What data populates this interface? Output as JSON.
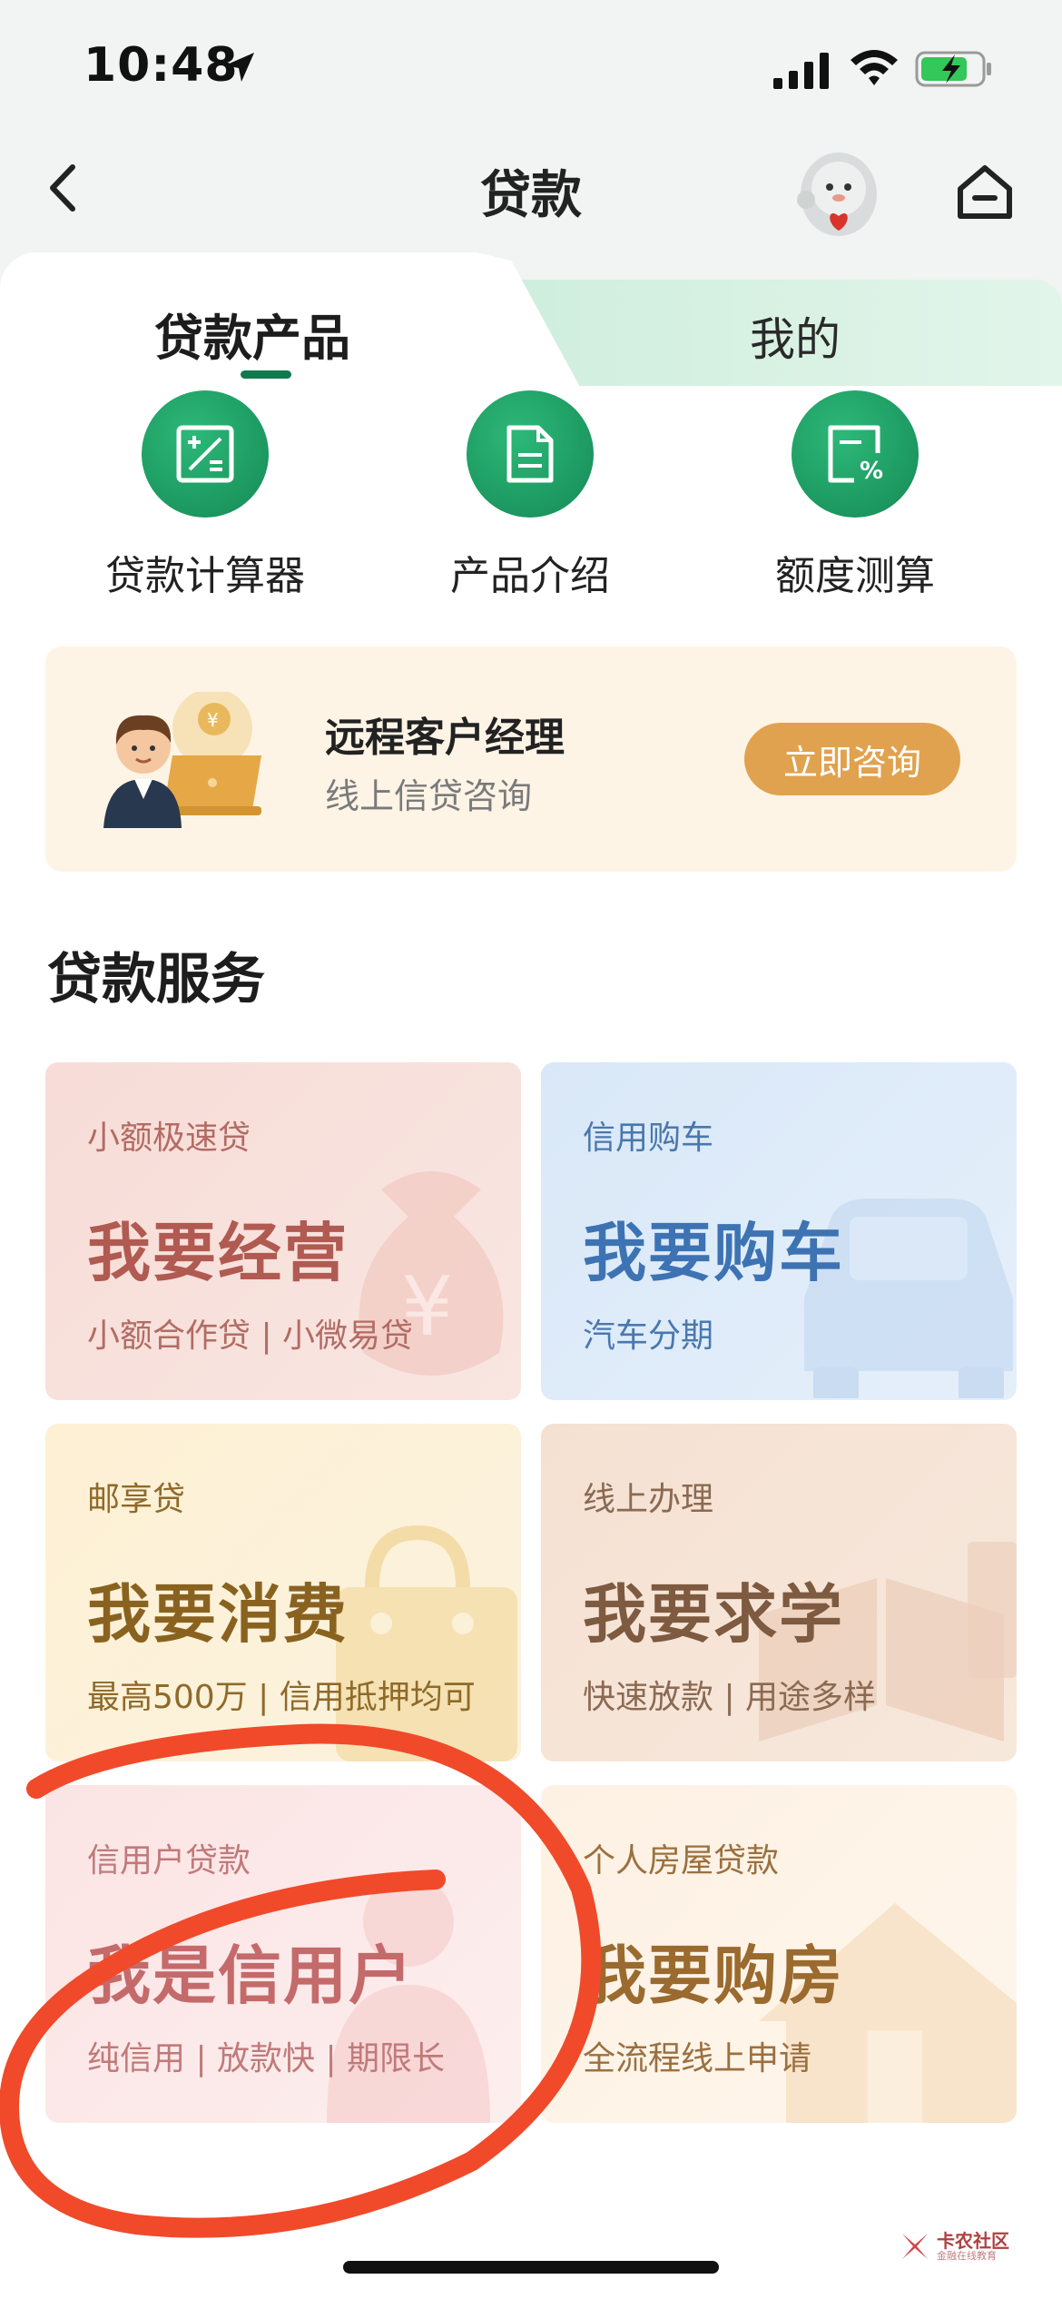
{
  "status_bar": {
    "time": "10:48"
  },
  "nav": {
    "title": "贷款"
  },
  "tabs": [
    {
      "label": "贷款产品",
      "active": true
    },
    {
      "label": "我的",
      "active": false
    }
  ],
  "tools": [
    {
      "label": "贷款计算器",
      "icon": "calculator-icon"
    },
    {
      "label": "产品介绍",
      "icon": "document-icon"
    },
    {
      "label": "额度测算",
      "icon": "quota-icon"
    }
  ],
  "manager_banner": {
    "title": "远程客户经理",
    "subtitle": "线上信贷咨询",
    "button": "立即咨询"
  },
  "services": {
    "title": "贷款服务",
    "cards": [
      {
        "eyebrow": "小额极速贷",
        "title": "我要经营",
        "subtitle": "小额合作贷 | 小微易贷"
      },
      {
        "eyebrow": "信用购车",
        "title": "我要购车",
        "subtitle": "汽车分期"
      },
      {
        "eyebrow": "邮享贷",
        "title": "我要消费",
        "subtitle": "最高500万 | 信用抵押均可"
      },
      {
        "eyebrow": "线上办理",
        "title": "我要求学",
        "subtitle": "快速放款 | 用途多样"
      },
      {
        "eyebrow": "信用户贷款",
        "title": "我是信用户",
        "subtitle": "纯信用 | 放款快 | 期限长"
      },
      {
        "eyebrow": "个人房屋贷款",
        "title": "我要购房",
        "subtitle": "全流程线上申请"
      }
    ]
  },
  "watermark": {
    "text": "卡农社区",
    "sub": "金融在线教育"
  },
  "colors": {
    "brand_green": "#148a55",
    "consult_button": "#e0a24e",
    "annotation_red": "#f04a2a"
  }
}
